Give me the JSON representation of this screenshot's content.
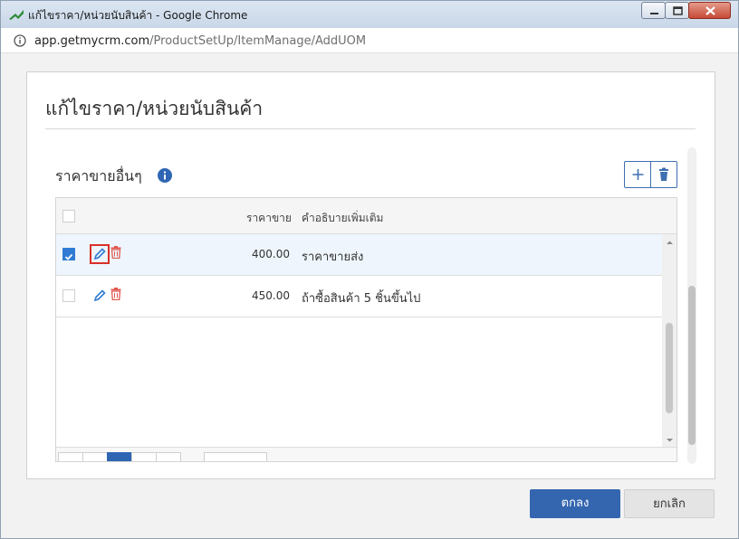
{
  "window": {
    "title": "แก้ไขราคา/หน่วยนับสินค้า - Google Chrome"
  },
  "address_bar": {
    "domain": "app.getmycrm.com",
    "path": "/ProductSetUp/ItemManage/AddUOM"
  },
  "dialog": {
    "title": "แก้ไขราคา/หน่วยนับสินค้า",
    "section_title": "ราคาขายอื่นๆ",
    "grid": {
      "columns": [
        "ราคาขาย",
        "คำอธิบายเพิ่มเติม"
      ],
      "rows": [
        {
          "price": "400.00",
          "description": "ราคาขายส่ง",
          "checked": true
        },
        {
          "price": "450.00",
          "description": "ถ้าซื้อสินค้า 5 ชิ้นขึ้นไป",
          "checked": false
        }
      ]
    },
    "ok_label": "ตกลง",
    "cancel_label": "ยกเลิก"
  },
  "colors": {
    "primary": "#3466b0",
    "checkbox_checked": "#2f7bd3",
    "edit_icon": "#2f7bd3",
    "delete_icon": "#e0584f",
    "focus_border": "#d9302a"
  },
  "icons": [
    "app-logo-icon",
    "info-icon",
    "plus-icon",
    "trash-icon",
    "pencil-icon",
    "checkmark-icon"
  ]
}
